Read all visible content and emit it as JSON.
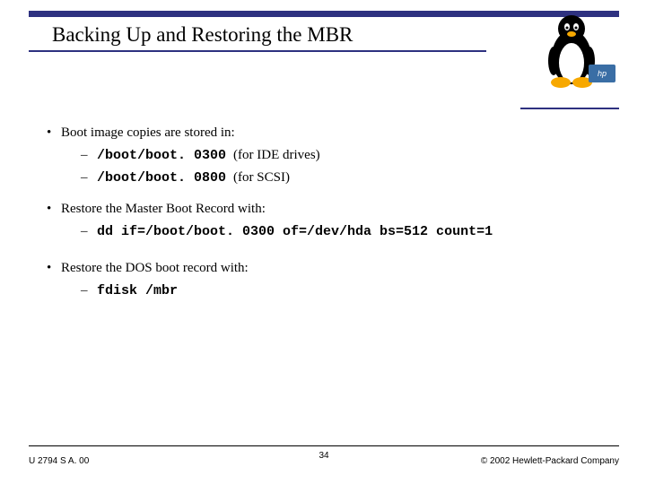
{
  "title": "Backing Up and Restoring the MBR",
  "logo": {
    "hp_label": "hp"
  },
  "bullets": [
    {
      "text": "Boot image copies are stored in:",
      "subs": [
        {
          "code": "/boot/boot. 0300",
          "note": "(for IDE drives)"
        },
        {
          "code": "/boot/boot. 0800",
          "note": "(for SCSI)"
        }
      ]
    },
    {
      "text": "Restore the Master Boot Record with:",
      "subs": [
        {
          "code": "dd if=/boot/boot. 0300 of=/dev/hda bs=512 count=1",
          "note": ""
        }
      ]
    },
    {
      "text": "Restore the DOS boot record with:",
      "subs": [
        {
          "code": "fdisk /mbr",
          "note": ""
        }
      ]
    }
  ],
  "footer": {
    "left": "U 2794 S A. 00",
    "center": "34",
    "right": "© 2002 Hewlett-Packard Company"
  }
}
